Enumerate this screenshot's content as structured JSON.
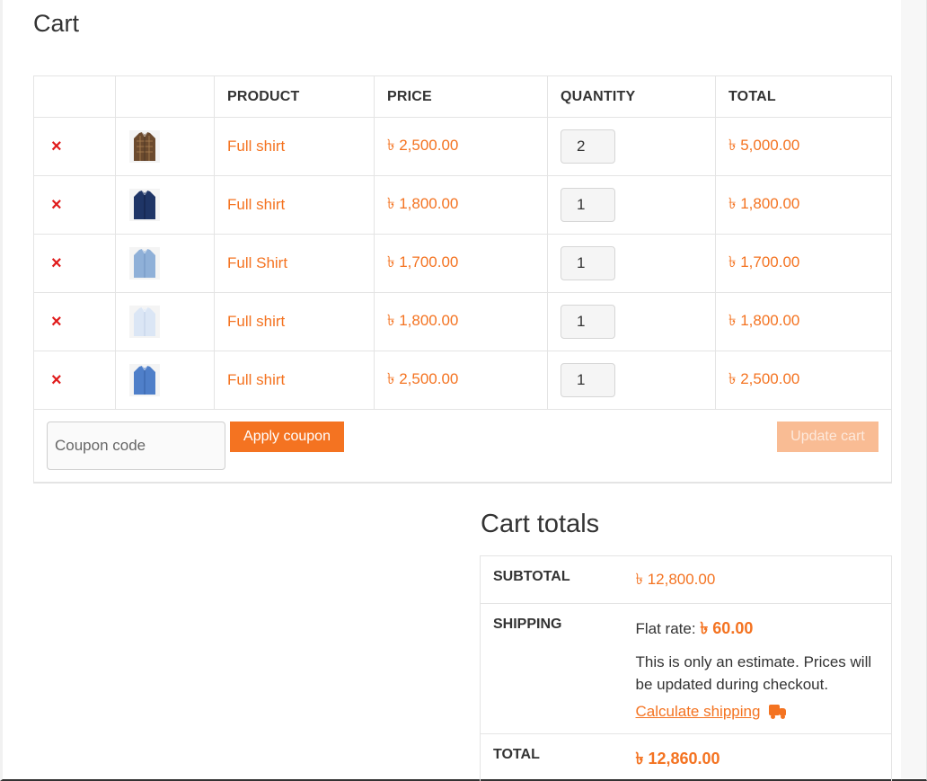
{
  "page": {
    "title": "Cart"
  },
  "currency_symbol": "৳",
  "cart_table": {
    "headers": {
      "product": "PRODUCT",
      "price": "PRICE",
      "quantity": "QUANTITY",
      "total": "TOTAL"
    },
    "remove_glyph": "×",
    "rows": [
      {
        "product": "Full shirt",
        "price": "৳ 2,500.00",
        "quantity": "2",
        "total": "৳ 5,000.00",
        "thumb": "brown-plaid-shirt"
      },
      {
        "product": "Full shirt",
        "price": "৳ 1,800.00",
        "quantity": "1",
        "total": "৳ 1,800.00",
        "thumb": "navy-shirt"
      },
      {
        "product": "Full Shirt",
        "price": "৳ 1,700.00",
        "quantity": "1",
        "total": "৳ 1,700.00",
        "thumb": "light-blue-shirt"
      },
      {
        "product": "Full shirt",
        "price": "৳ 1,800.00",
        "quantity": "1",
        "total": "৳ 1,800.00",
        "thumb": "pale-blue-shirt"
      },
      {
        "product": "Full shirt",
        "price": "৳ 2,500.00",
        "quantity": "1",
        "total": "৳ 2,500.00",
        "thumb": "blue-shirt"
      }
    ],
    "coupon_placeholder": "Coupon code",
    "apply_coupon_label": "Apply coupon",
    "update_cart_label": "Update cart"
  },
  "totals": {
    "title": "Cart totals",
    "subtotal_label": "SUBTOTAL",
    "subtotal_value": "৳ 12,800.00",
    "shipping_label": "SHIPPING",
    "shipping_prefix": "Flat rate:",
    "shipping_value": "৳ 60.00",
    "shipping_note": "This is only an estimate. Prices will be updated during checkout.",
    "calculate_shipping_label": "Calculate shipping",
    "total_label": "TOTAL",
    "total_value": "৳ 12,860.00"
  },
  "colors": {
    "accent": "#f47321",
    "remove": "#e01b1b",
    "update_disabled": "#f9bc94"
  }
}
